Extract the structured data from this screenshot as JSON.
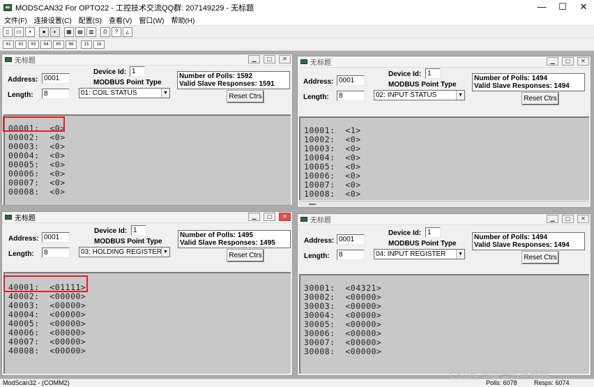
{
  "app": {
    "title": "MODSCAN32 For OPTO22 - 工控技术交流QQ群: 207149229 - 无标题",
    "controls": {
      "minimize": "—",
      "maximize": "☐",
      "close": "✕"
    }
  },
  "menu": [
    "文件(F)",
    "连接设置(C)",
    "配置(S)",
    "查看(V)",
    "窗口(W)",
    "帮助(H)"
  ],
  "toolbar_icons": [
    "new-doc-icon",
    "open-folder-icon",
    "save-icon",
    "connect-icon",
    "disconnect-icon",
    "display-config-icon",
    "display-hex-icon",
    "display-dec-icon",
    "print-icon",
    "help-icon",
    "context-help-icon"
  ],
  "toolbar2_labels": [
    "01",
    "02",
    "03",
    "04",
    "05",
    "06",
    "15",
    "16"
  ],
  "windows": [
    {
      "title": "无标题",
      "address": "0001",
      "length": "8",
      "device_id": "1",
      "device_id_label": "Device Id:",
      "point_type_label": "MODBUS Point Type",
      "point_type": "01: COIL STATUS",
      "polls": "Number of Polls: 1592",
      "responses": "Valid Slave Responses: 1591",
      "reset": "Reset Ctrs",
      "rows": [
        "00001:  <0>",
        "00002:  <0>",
        "00003:  <0>",
        "00004:  <0>",
        "00005:  <0>",
        "00006:  <0>",
        "00007:  <0>",
        "00008:  <0>"
      ]
    },
    {
      "title": "无标题",
      "address": "0001",
      "length": "8",
      "device_id": "1",
      "device_id_label": "Device Id:",
      "point_type_label": "MODBUS Point Type",
      "point_type": "02: INPUT STATUS",
      "polls": "Number of Polls: 1494",
      "responses": "Valid Slave Responses: 1494",
      "reset": "Reset Ctrs",
      "rows": [
        "10001:  <1>",
        "10002:  <0>",
        "10003:  <0>",
        "10004:  <0>",
        "10005:  <0>",
        "10006:  <0>",
        "10007:  <0>",
        "10008:  <0>"
      ]
    },
    {
      "title": "无标题",
      "address": "0001",
      "length": "8",
      "device_id": "1",
      "device_id_label": "Device Id:",
      "point_type_label": "MODBUS Point Type",
      "point_type": "03: HOLDING REGISTER",
      "polls": "Number of Polls: 1495",
      "responses": "Valid Slave Responses: 1495",
      "reset": "Reset Ctrs",
      "rows": [
        "40001:  <01111>",
        "40002:  <00000>",
        "40003:  <00000>",
        "40004:  <00000>",
        "40005:  <00000>",
        "40006:  <00000>",
        "40007:  <00000>",
        "40008:  <00000>"
      ]
    },
    {
      "title": "无标题",
      "address": "0001",
      "length": "8",
      "device_id": "1",
      "device_id_label": "Device Id:",
      "point_type_label": "MODBUS Point Type",
      "point_type": "04: INPUT REGISTER",
      "polls": "Number of Polls: 1494",
      "responses": "Valid Slave Responses: 1494",
      "reset": "Reset Ctrs",
      "rows": [
        "30001:  <04321>",
        "30002:  <00000>",
        "30003:  <00000>",
        "30004:  <00000>",
        "30005:  <00000>",
        "30006:  <00000>",
        "30007:  <00000>",
        "30008:  <00000>"
      ]
    }
  ],
  "labels": {
    "address": "Address:",
    "length": "Length:"
  },
  "status": {
    "left": "ModScan32 - (COMM2)",
    "polls": "Polls: 6078",
    "resps": "Resps: 6074"
  },
  "watermark": "CSDN @豪哥追求卓越",
  "accent": {
    "highlight": "#e02020",
    "data_bg": "#c8c8c8"
  }
}
